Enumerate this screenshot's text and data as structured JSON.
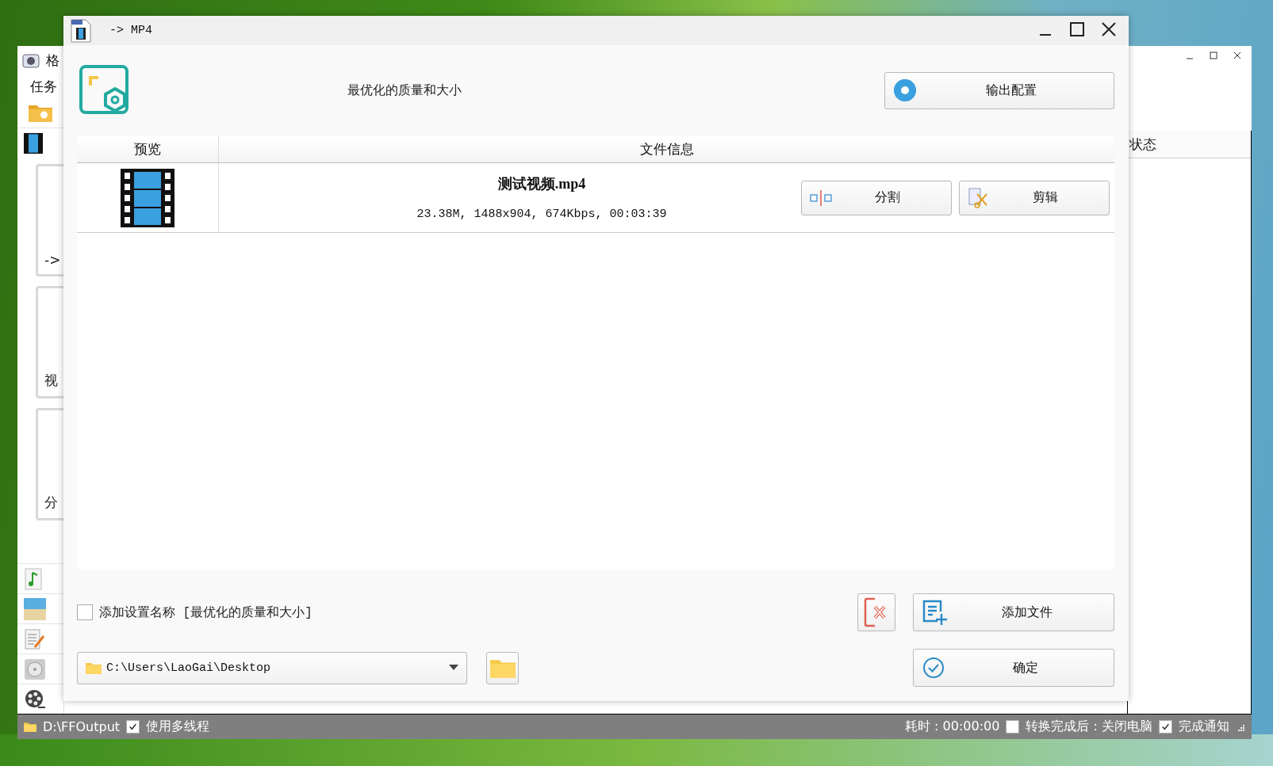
{
  "background_window": {
    "title": "格",
    "menu": [
      "任务"
    ],
    "sidebar_cards": [
      {
        "label": "->"
      },
      {
        "label": "视"
      },
      {
        "label": "分"
      }
    ],
    "column_header": "状态",
    "status_bar": {
      "output_folder": "D:\\FFOutput",
      "multithread": {
        "label": "使用多线程",
        "checked": true
      },
      "elapsed": "耗时 : 00:00:00",
      "shutdown": {
        "label": "转换完成后 : 关闭电脑",
        "checked": false
      },
      "notify": {
        "label": "完成通知",
        "checked": true
      }
    }
  },
  "dialog": {
    "title": "-> MP4",
    "profile": "最优化的质量和大小",
    "config_button": "输出配置",
    "columns": [
      "预览",
      "文件信息"
    ],
    "files": [
      {
        "name": "测试视频.mp4",
        "info": "23.38M, 1488x904, 674Kbps, 00:03:39",
        "actions": [
          {
            "kind": "split",
            "label": "分割"
          },
          {
            "kind": "trim",
            "label": "剪辑"
          }
        ]
      }
    ],
    "add_name": {
      "label": "添加设置名称 [最优化的质量和大小]",
      "checked": false
    },
    "output_path": "C:\\Users\\LaoGai\\Desktop",
    "add_button": "添加文件",
    "ok_button": "确定"
  }
}
